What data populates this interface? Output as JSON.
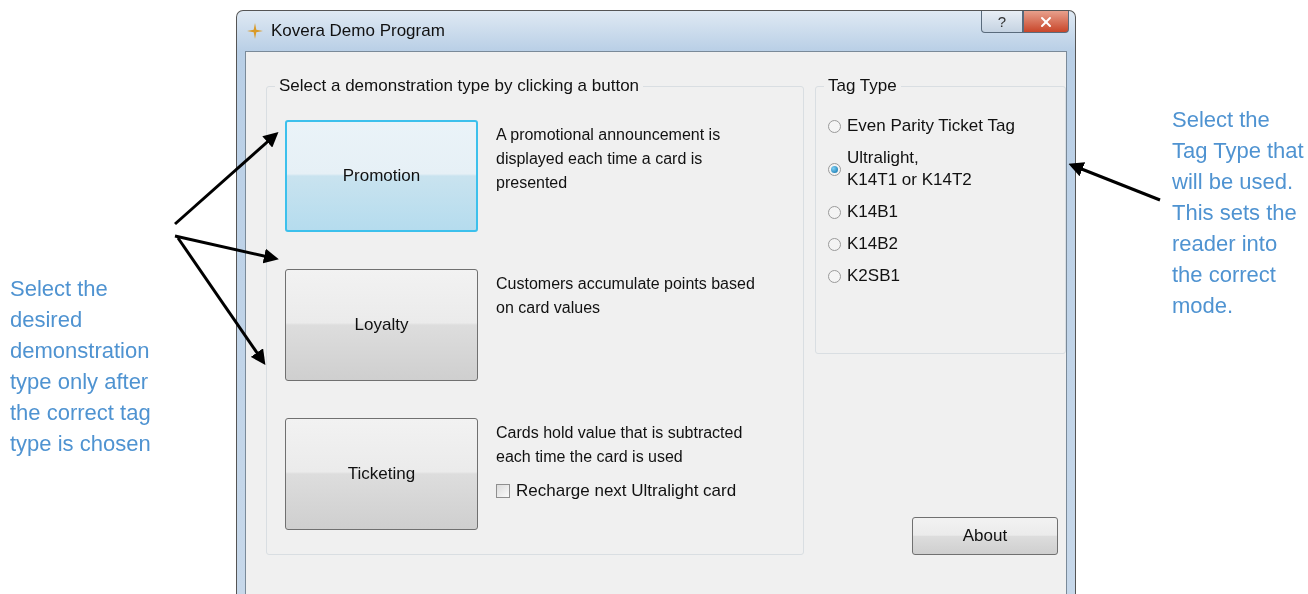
{
  "annotations": {
    "left": "Select the desired demonstration type only after the correct tag type is chosen",
    "right": "Select the Tag Type that will be used. This sets the reader into the correct mode."
  },
  "window": {
    "title": "Kovera Demo Program",
    "help_button": "?"
  },
  "demo_group": {
    "title": "Select a demonstration type by clicking a button",
    "demos": [
      {
        "label": "Promotion",
        "description": "A promotional announcement is displayed each time a card is presented",
        "focused": true
      },
      {
        "label": "Loyalty",
        "description": "Customers accumulate points based on card values",
        "focused": false
      },
      {
        "label": "Ticketing",
        "description": "Cards hold value that is subtracted each time the card is used",
        "focused": false,
        "option": {
          "label": "Recharge next Ultralight card",
          "checked": false
        }
      }
    ]
  },
  "tag_group": {
    "title": "Tag Type",
    "options": [
      {
        "label": "Even Parity Ticket Tag",
        "selected": false
      },
      {
        "label": "Ultralight,\nK14T1 or K14T2",
        "selected": true
      },
      {
        "label": "K14B1",
        "selected": false
      },
      {
        "label": "K14B2",
        "selected": false
      },
      {
        "label": "K2SB1",
        "selected": false
      }
    ]
  },
  "buttons": [
    "About"
  ]
}
